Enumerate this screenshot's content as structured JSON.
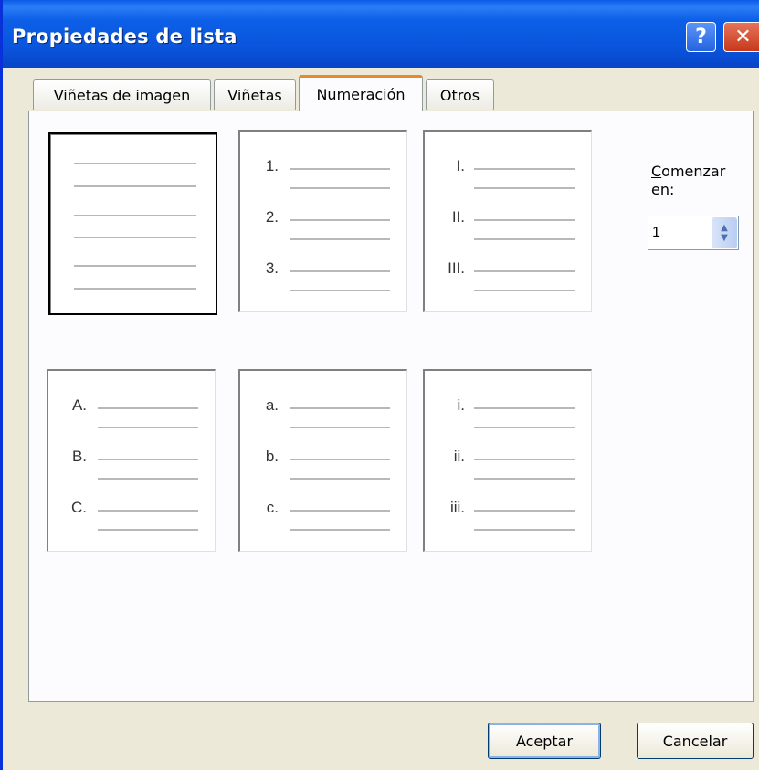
{
  "window": {
    "title": "Propiedades de lista"
  },
  "tabs": [
    {
      "label": "Viñetas de imagen"
    },
    {
      "label": "Viñetas"
    },
    {
      "label": "Numeración",
      "active": true
    },
    {
      "label": "Otros"
    }
  ],
  "styles": [
    {
      "name": "ninguno",
      "labels": [
        "",
        "",
        ""
      ],
      "selected": true
    },
    {
      "name": "numeros",
      "labels": [
        "1.",
        "2.",
        "3."
      ]
    },
    {
      "name": "romanos-mayusculas",
      "labels": [
        "I.",
        "II.",
        "III."
      ]
    },
    {
      "name": "letras-mayusculas",
      "labels": [
        "A.",
        "B.",
        "C."
      ]
    },
    {
      "name": "letras-minusculas",
      "labels": [
        "a.",
        "b.",
        "c."
      ]
    },
    {
      "name": "romanos-minusculas",
      "labels": [
        "i.",
        "ii.",
        "iii."
      ]
    }
  ],
  "start": {
    "label_mnemonic": "C",
    "label_rest": "omenzar",
    "label_line2": "en:",
    "value": "1"
  },
  "buttons": {
    "ok": "Aceptar",
    "cancel": "Cancelar"
  },
  "icons": {
    "help": "help-icon",
    "close": "close-icon",
    "spinner": "spinner-arrows-icon"
  },
  "colors": {
    "titlebar": "#0a55dc",
    "dialog_bg": "#ece9d8",
    "active_tab_accent": "#e68b2c"
  }
}
